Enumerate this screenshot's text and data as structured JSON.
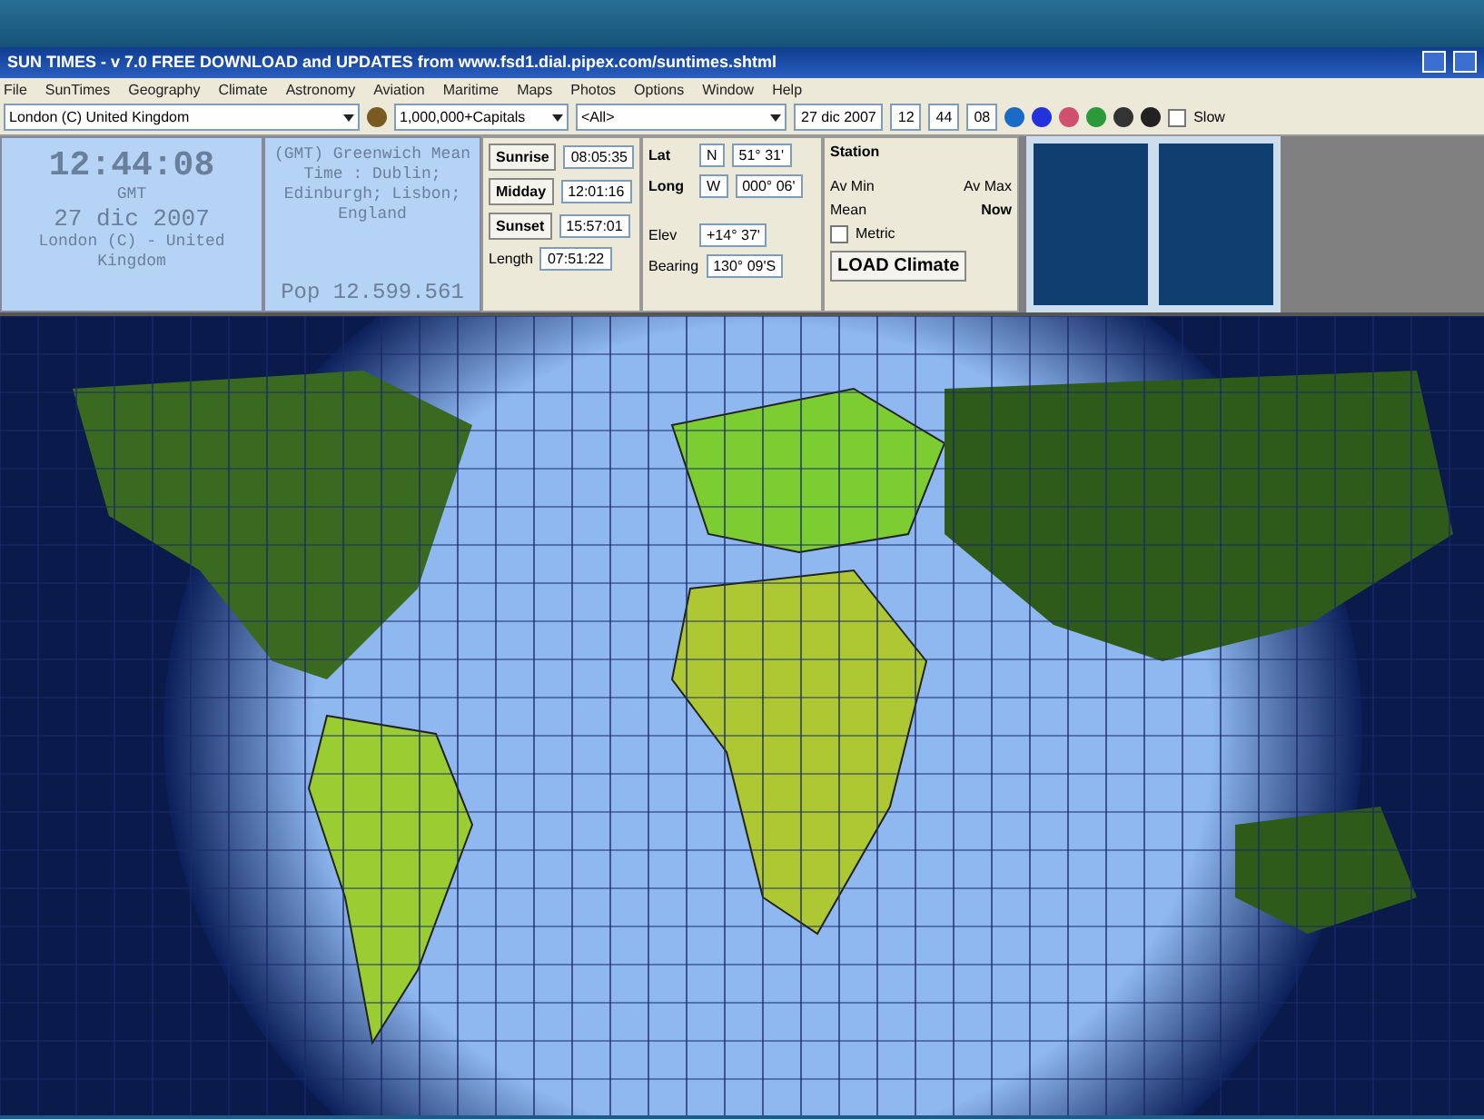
{
  "window": {
    "title": "SUN TIMES  -  v 7.0 FREE DOWNLOAD and UPDATES from www.fsd1.dial.pipex.com/suntimes.shtml"
  },
  "menu": [
    "File",
    "SunTimes",
    "Geography",
    "Climate",
    "Astronomy",
    "Aviation",
    "Maritime",
    "Maps",
    "Photos",
    "Options",
    "Window",
    "Help"
  ],
  "toolbar": {
    "location": "London (C) United Kingdom",
    "filter": "1,000,000+Capitals",
    "region": "<All>",
    "date": "27 dic 2007",
    "hour": "12",
    "minute": "44",
    "second": "08",
    "slow": {
      "label": "Slow",
      "checked": false
    }
  },
  "clock": {
    "time": "12:44:08",
    "zone": "GMT",
    "date": "27 dic 2007",
    "place": "London (C) - United Kingdom"
  },
  "timezone": {
    "text": "(GMT) Greenwich Mean Time : Dublin; Edinburgh; Lisbon; England",
    "population": "Pop 12.599.561"
  },
  "sun": [
    {
      "label": "Sunrise",
      "value": "08:05:35"
    },
    {
      "label": "Midday",
      "value": "12:01:16"
    },
    {
      "label": "Sunset",
      "value": "15:57:01"
    }
  ],
  "length": {
    "label": "Length",
    "value": "07:51:22"
  },
  "coords": {
    "lat": {
      "label": "Lat",
      "hemi": "N",
      "value": "51° 31'"
    },
    "long": {
      "label": "Long",
      "hemi": "W",
      "value": "000° 06'"
    },
    "elev": {
      "label": "Elev",
      "value": "+14° 37'"
    },
    "bearing": {
      "label": "Bearing",
      "value": "130° 09'S"
    }
  },
  "climate": {
    "station": "Station",
    "av_min": "Av Min",
    "av_max": "Av Max",
    "mean": "Mean",
    "now": "Now",
    "metric": {
      "label": "Metric",
      "checked": false
    },
    "button": "LOAD Climate"
  }
}
